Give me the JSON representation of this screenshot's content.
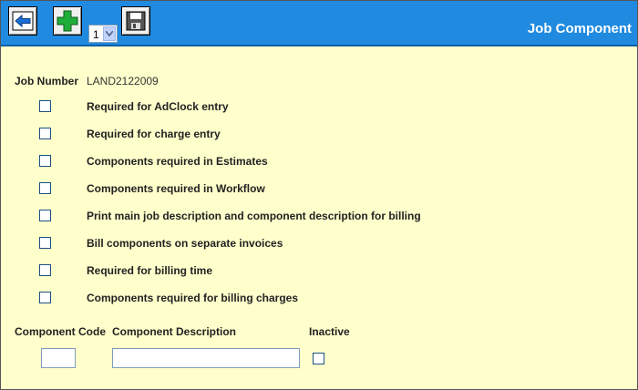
{
  "header": {
    "title": "Job Component",
    "page_select_value": "1"
  },
  "toolbar": {
    "icons": [
      "back-arrow-icon",
      "add-plus-icon",
      "save-disk-icon"
    ]
  },
  "job": {
    "number_label": "Job Number",
    "number_value": "LAND2122009"
  },
  "options": [
    {
      "label": "Required for AdClock entry",
      "checked": false
    },
    {
      "label": "Required for charge entry",
      "checked": false
    },
    {
      "label": "Components required in Estimates",
      "checked": false
    },
    {
      "label": "Components required in Workflow",
      "checked": false
    },
    {
      "label": "Print main job description and component description for billing",
      "checked": false
    },
    {
      "label": "Bill components on separate invoices",
      "checked": false
    },
    {
      "label": "Required for billing time",
      "checked": false
    },
    {
      "label": "Components required for billing charges",
      "checked": false
    }
  ],
  "component_form": {
    "code_label": "Component Code",
    "description_label": "Component Description",
    "inactive_label": "Inactive",
    "code_value": "",
    "description_value": "",
    "inactive_checked": false
  },
  "colors": {
    "header_blue": "#1f8ae0",
    "background": "#ffffcc",
    "checkbox_border": "#1c5180"
  }
}
